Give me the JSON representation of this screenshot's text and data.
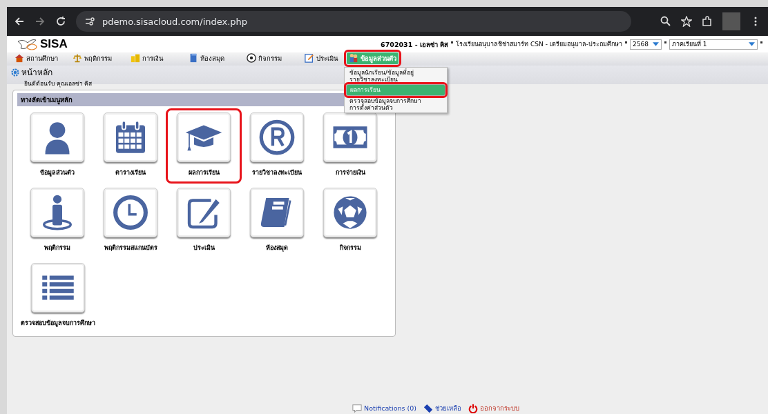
{
  "browser": {
    "url": "pdemo.sisacloud.com/index.php"
  },
  "header": {
    "logo_text": "SISA",
    "user_info": "6702031 - เอลซ่า คิส",
    "school": "โรงเรียนอนุบาลชิช่าสมาร์ท CSN - เตรียมอนุบาล-ประถมศึกษา",
    "year_select": "2568",
    "term_select": "ภาคเรียนที่ 1"
  },
  "nav": [
    {
      "label": "สถานศึกษา",
      "kind": "house",
      "open": false,
      "highlighted": false
    },
    {
      "label": "พฤติกรรม",
      "kind": "scale",
      "open": false,
      "highlighted": false
    },
    {
      "label": "การเงิน",
      "kind": "coins",
      "open": false,
      "highlighted": false
    },
    {
      "label": "ห้องสมุด",
      "kind": "book",
      "open": false,
      "highlighted": false
    },
    {
      "label": "กิจกรรม",
      "kind": "ball",
      "open": false,
      "highlighted": false
    },
    {
      "label": "ประเมิน",
      "kind": "note",
      "open": false,
      "highlighted": false
    },
    {
      "label": "ข้อมูลส่วนตัว",
      "kind": "people",
      "open": true,
      "highlighted": true,
      "menu": [
        {
          "label": "ข้อมูลนักเรียน/ข้อมูลที่อยู่",
          "selected": false,
          "highlighted": false
        },
        {
          "label": "รายวิชาลงทะเบียน",
          "selected": false,
          "highlighted": false
        },
        {
          "label": "ผลการเรียน",
          "selected": true,
          "highlighted": true
        },
        {
          "label": "ตรวจสอบข้อมูลจบการศึกษา",
          "selected": false,
          "highlighted": false
        },
        {
          "label": "การตั้งค่าส่วนตัว",
          "selected": false,
          "highlighted": false
        }
      ]
    }
  ],
  "breadcrumb": {
    "title": "หน้าหลัก",
    "welcome": "ยินดีต้อนรับ คุณเอลซ่า คิส"
  },
  "panel": {
    "title": "ทางลัดเข้าเมนูหลัก",
    "tiles": [
      {
        "label": "ข้อมูลส่วนตัว",
        "kind": "person",
        "highlighted": false
      },
      {
        "label": "ตารางเรียน",
        "kind": "calendar",
        "highlighted": false
      },
      {
        "label": "ผลการเรียน",
        "kind": "cap",
        "highlighted": true
      },
      {
        "label": "รายวิชาลงทะเบียน",
        "kind": "registered",
        "highlighted": false
      },
      {
        "label": "การจ่ายเงิน",
        "kind": "banknote",
        "highlighted": false
      },
      {
        "label": "พฤติกรรม",
        "kind": "standing",
        "highlighted": false
      },
      {
        "label": "พฤติกรรมสแกนบัตร",
        "kind": "clock",
        "highlighted": false
      },
      {
        "label": "ประเมิน",
        "kind": "edit",
        "highlighted": false
      },
      {
        "label": "ห้องสมุด",
        "kind": "book",
        "highlighted": false
      },
      {
        "label": "กิจกรรม",
        "kind": "ball",
        "highlighted": false
      },
      {
        "label": "ตรวจสอบข้อมูลจบการศึกษา",
        "kind": "list",
        "highlighted": false
      }
    ]
  },
  "footer": [
    {
      "label": "Notifications (0)",
      "kind": "chat"
    },
    {
      "label": "ช่วยเหลือ",
      "kind": "tag"
    },
    {
      "label": "ออกจากระบบ",
      "kind": "power"
    }
  ]
}
